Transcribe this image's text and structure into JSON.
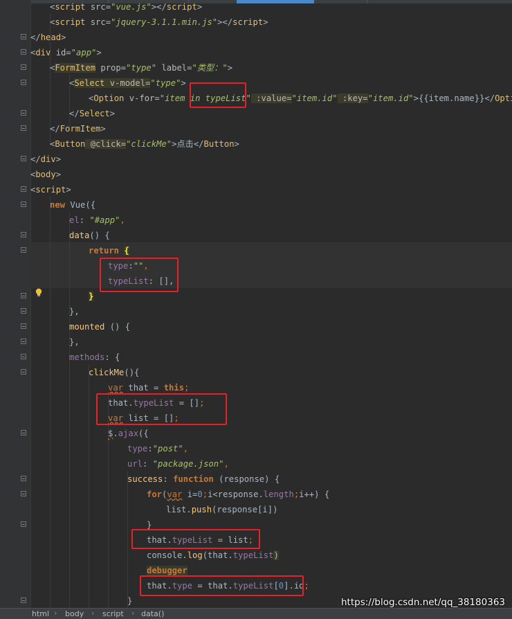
{
  "code": {
    "l1": [
      "<",
      "script",
      " src=",
      "\"vue.js\"",
      "></",
      "script",
      ">"
    ],
    "l2": [
      "<",
      "script",
      " src=",
      "\"jquery-3.1.1.min.js\"",
      "></",
      "script",
      ">"
    ],
    "l3": [
      "</",
      "head",
      ">"
    ],
    "l4": [
      "<",
      "div",
      " id=",
      "\"app\"",
      ">"
    ],
    "l5": [
      "<",
      "FormItem",
      " prop=",
      "\"type\"",
      " label=",
      "\"类型：\"",
      ">"
    ],
    "l6": [
      "<",
      "Select",
      " v-model=",
      "\"type\"",
      ">"
    ],
    "l7": [
      "<",
      "Option",
      " v-for=",
      "\"item in typeList\"",
      " :value=",
      "\"item.id\"",
      " :key=",
      "\"item.id\"",
      ">{{item.name}}</",
      "Option",
      ">"
    ],
    "l8": [
      "</",
      "Select",
      ">"
    ],
    "l9": [
      "</",
      "FormItem",
      ">"
    ],
    "l10": [
      "<",
      "Button",
      " @click=",
      "\"clickMe\"",
      ">点击</",
      "Button",
      ">"
    ],
    "l11": [
      "</",
      "div",
      ">"
    ],
    "l12": [
      "<",
      "body",
      ">"
    ],
    "l13": [
      "<",
      "script",
      ">"
    ],
    "l14": [
      "new",
      " ",
      "Vue",
      "({"
    ],
    "l15": [
      "el",
      ": ",
      "\"#app\"",
      ","
    ],
    "l16": [
      "data",
      "() {"
    ],
    "l17": [
      "return",
      " ",
      "{"
    ],
    "l18": [
      "type",
      ":",
      "\"\"",
      ","
    ],
    "l19": [
      "typeList",
      ": [],"
    ],
    "l20": [
      "}"
    ],
    "l21": [
      "},"
    ],
    "l22": [
      "mounted",
      " () {"
    ],
    "l23": [
      "},"
    ],
    "l24": [
      "methods",
      ": {"
    ],
    "l25": [
      "clickMe",
      "(){"
    ],
    "l26": [
      "var",
      " that = ",
      "this",
      ";"
    ],
    "l27": [
      "that.",
      "typeList",
      " = []",
      ";"
    ],
    "l28": [
      "var",
      " list = []",
      ";"
    ],
    "l29": [
      "$",
      ".",
      "ajax",
      "({"
    ],
    "l30": [
      "type",
      ":",
      "\"post\"",
      ","
    ],
    "l31": [
      "url",
      ": ",
      "\"package.json\"",
      ","
    ],
    "l32": [
      "success",
      ": ",
      "function",
      " (response) {"
    ],
    "l33": [
      "for",
      "(",
      "var",
      " i=",
      "0",
      ";",
      "i<response.",
      "length",
      ";",
      "i++) {"
    ],
    "l34": [
      "list.",
      "push",
      "(response[i])"
    ],
    "l35": [
      "}"
    ],
    "l36": [
      "that.",
      "typeList",
      " = list",
      ";"
    ],
    "l37": [
      "console.",
      "log",
      "(that.",
      "typeList",
      ")"
    ],
    "l38": [
      "debugger"
    ],
    "l39": [
      "that.",
      "type",
      " = that.",
      "typeList",
      "[",
      "0",
      "].id",
      ";"
    ],
    "l40": [
      "}"
    ]
  },
  "breadcrumb": [
    "html",
    "body",
    "script",
    "data()"
  ],
  "watermark": "https://blog.csdn.net/qq_38180363",
  "icons": {
    "lightbulb": "intention-bulb-icon",
    "fold": "fold-marker-icon"
  },
  "colors": {
    "background": "#2b2b2b",
    "tag": "#e8bf6a",
    "string": "#a5c25c",
    "keyword": "#cc7832",
    "property": "#9876aa",
    "function": "#ffc66d",
    "highlight_box": "#e8202a"
  }
}
